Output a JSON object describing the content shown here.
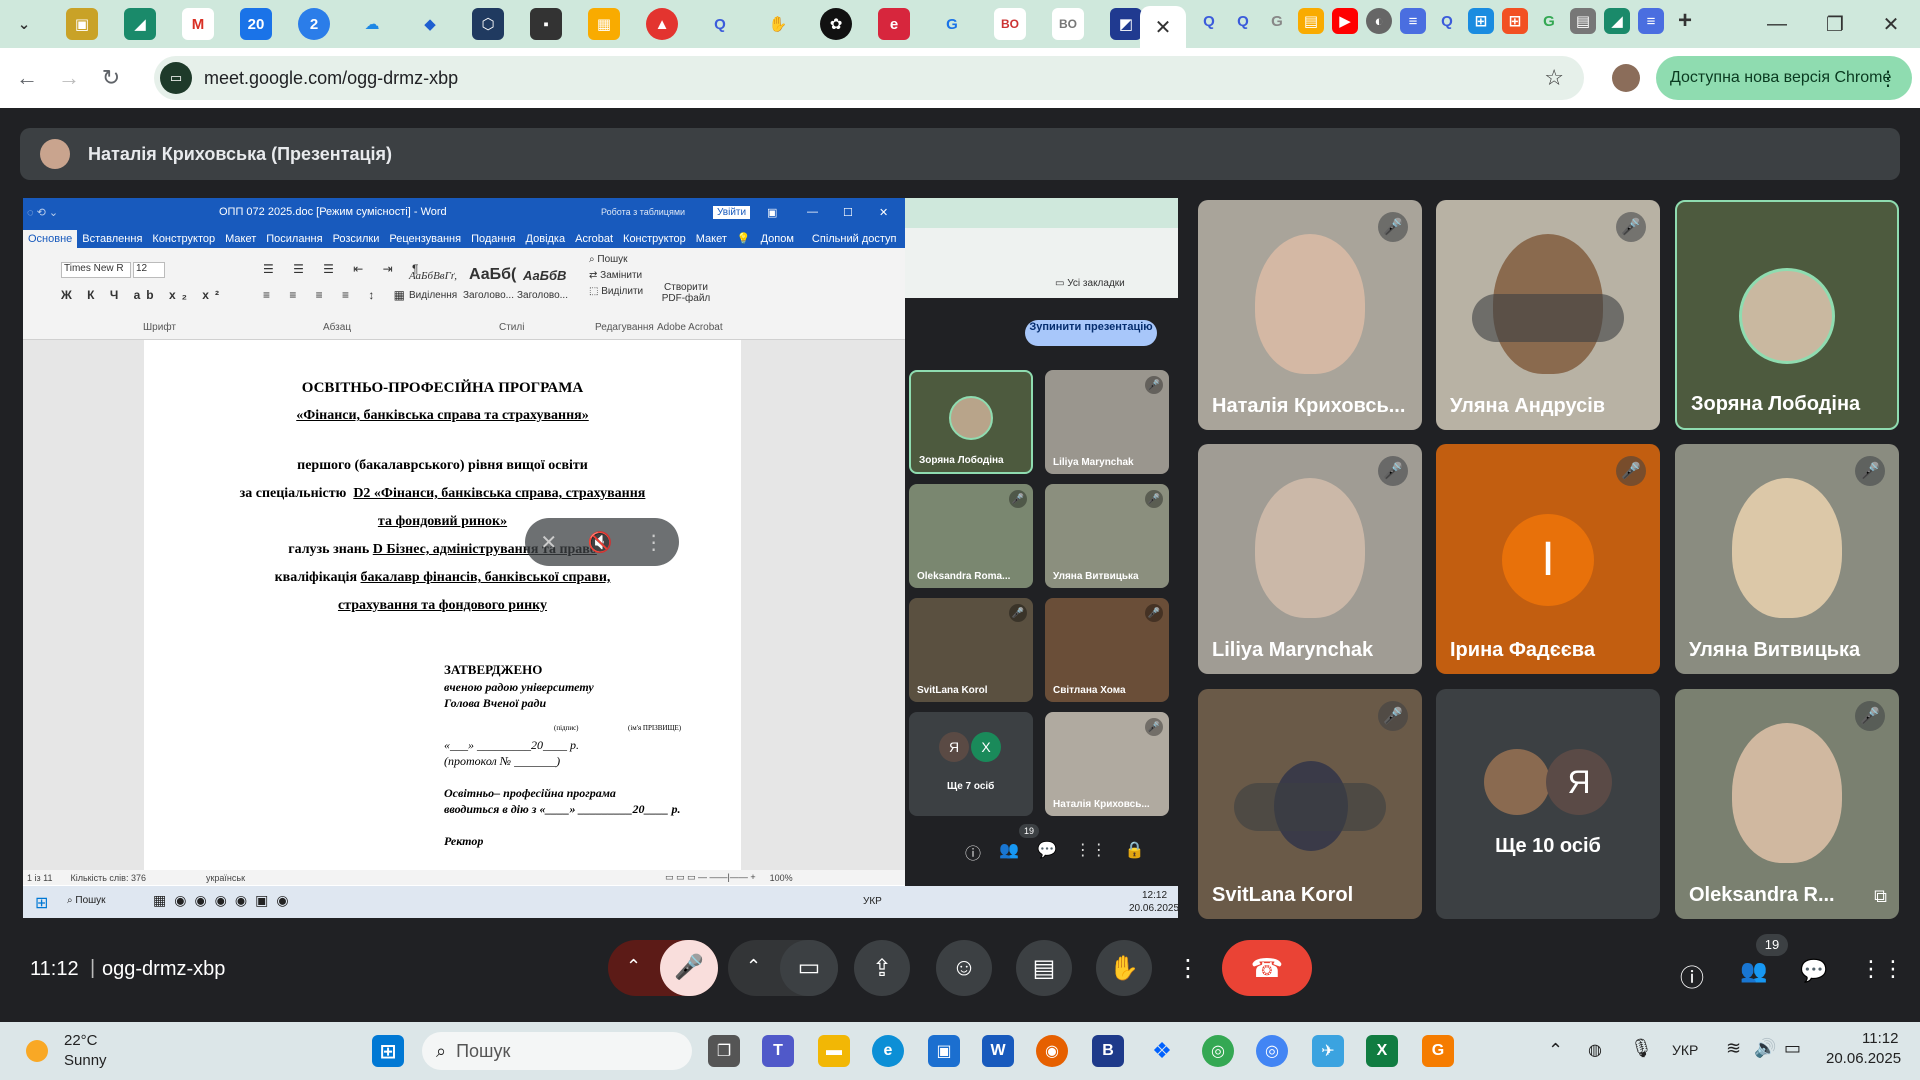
{
  "browser": {
    "url": "meet.google.com/ogg-drmz-xbp",
    "update_button": "Доступна нова версія Chrome",
    "tab_icons": [
      "chevron-down",
      "briefcase",
      "slides",
      "gmail",
      "calendar",
      "circle-2",
      "cloud",
      "diamond",
      "cube",
      "id-card",
      "chart",
      "acrobat",
      "q",
      "hand",
      "openai",
      "e",
      "g",
      "bo",
      "bo",
      "ie",
      "meet"
    ]
  },
  "meet": {
    "presenter_label": "Наталія Криховська (Презентація)",
    "time": "11:12",
    "separator": "|",
    "meeting_code": "ogg-drmz-xbp",
    "participant_count": "19"
  },
  "word": {
    "title": "ОПП 072 2025.doc [Режим сумісності]  -  Word",
    "table_work": "Робота з таблицями",
    "signin": "Увійти",
    "tabs": [
      "Основне",
      "Вставлення",
      "Конструктор",
      "Макет",
      "Посилання",
      "Розсилки",
      "Рецензування",
      "Подання",
      "Довідка",
      "Acrobat",
      "Конструктор",
      "Макет"
    ],
    "help_label": "Допом",
    "share_label": "Спільний доступ",
    "font_name": "Times New R",
    "font_size": "12",
    "group_font": "Шрифт",
    "group_paragraph": "Абзац",
    "group_styles": "Стилі",
    "group_editing": "Редагування",
    "group_acrobat": "Adobe Acrobat",
    "styles": [
      {
        "sample": "АаБбВвГґ,",
        "label": "Виділення"
      },
      {
        "sample": "АаБб(",
        "label": "Заголово..."
      },
      {
        "sample": "АаБбВ",
        "label": "Заголово..."
      }
    ],
    "find": "Пошук",
    "replace": "Замінити",
    "select": "Виділити",
    "create_pdf": "Створити PDF-файл",
    "status_page": "1 із 11",
    "status_words": "Кількість слів: 376",
    "status_lang": "українськ",
    "zoom": "100%"
  },
  "document": {
    "line1": "ОСВІТНЬО-ПРОФЕСІЙНА ПРОГРАМА",
    "line2": "«Фінанси, банківська справа та страхування»",
    "line3": "першого (бакалаврського) рівня вищої освіти",
    "line4_a": "за спеціальністю",
    "line4_b": "D2 «Фінанси, банківська справа, страхування",
    "line5": "та фондовий ринок»",
    "line6_a": "галузь знань",
    "line6_b": "D Бізнес, адміністрування та право",
    "line7_a": "кваліфікація",
    "line7_b": "бакалавр фінансів, банківської справи,",
    "line8": "страхування та фондового ринку",
    "approved": "ЗАТВЕРДЖЕНО",
    "approved_by": "вченою радою університету",
    "head": "Голова Вченої ради",
    "sign": "(підпис)",
    "name_hint": "(ім'я ПРІЗВИЩЕ)",
    "date": "«___» _________20____ р.",
    "protocol": "(протокол № _______)",
    "program": "Освітньо– професійна програма",
    "enacted": "вводиться в дію з «____» _________20____ р.",
    "rector": "Ректор"
  },
  "win_inner_taskbar": {
    "search": "Пошук",
    "lang": "УКР",
    "time": "12:12",
    "date": "20.06.2025"
  },
  "mini_meet": {
    "stop_presenting": "Зупинити презентацію",
    "bookmarks": "Усі закладки",
    "tiles": [
      {
        "name": "Зоряна Лободіна"
      },
      {
        "name": "Liliya Marynchak"
      },
      {
        "name": "Oleksandra Roma..."
      },
      {
        "name": "Уляна Витвицька"
      },
      {
        "name": "SvitLana Korol"
      },
      {
        "name": "Світлана Хома"
      },
      {
        "name": "Ще 7 осіб"
      },
      {
        "name": "Наталія Криховсь..."
      }
    ],
    "more_avatars": [
      "Я",
      "X"
    ],
    "count": "19"
  },
  "tiles": [
    {
      "name": "Наталія Криховсь...",
      "muted": true
    },
    {
      "name": "Уляна Андрусів",
      "muted": true
    },
    {
      "name": "Зоряна Лободіна",
      "muted": false
    },
    {
      "name": "Liliya Marynchak",
      "muted": true
    },
    {
      "name": "Ірина Фадєєва",
      "muted": true,
      "initial": "І"
    },
    {
      "name": "Уляна Витвицька",
      "muted": true
    },
    {
      "name": "SvitLana Korol",
      "muted": true
    },
    {
      "name": "Ще 10 осіб",
      "muted": false,
      "initial": "Я"
    },
    {
      "name": "Oleksandra R...",
      "muted": true
    }
  ],
  "taskbar": {
    "temp": "22°C",
    "weather": "Sunny",
    "search": "Пошук",
    "lang": "УКР",
    "time": "11:12",
    "date": "20.06.2025"
  },
  "colors": {
    "accent_green": "#8fdcb0",
    "end_call": "#ea4335",
    "word_blue": "#185abd",
    "avatar_orange": "#e8710a"
  }
}
